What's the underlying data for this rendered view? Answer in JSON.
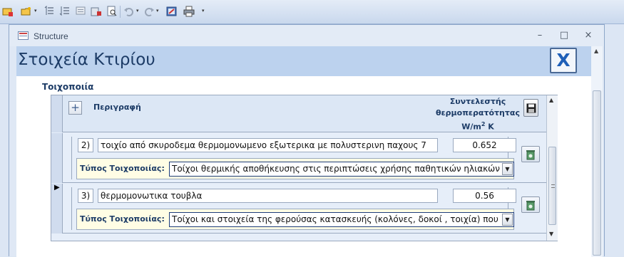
{
  "toolbar": {
    "buttons": [
      "new-record-icon",
      "find-icon",
      "sort-asc-icon",
      "sort-desc-icon",
      "filter-icon",
      "print-preview-icon",
      "undo-icon",
      "redo-icon",
      "report-icon",
      "print-icon",
      "customize-icon"
    ]
  },
  "window": {
    "title": "Structure",
    "minimize": "–",
    "maximize": "□",
    "close": "×"
  },
  "header": {
    "title": "Στοιχεία Κτιρίου",
    "close_label": "X"
  },
  "section": {
    "label": "Τοιχοποιία",
    "add_label": "+",
    "col_desc": "Περιγραφή",
    "col_coef_line1": "Συντελεστής",
    "col_coef_line2": "θερμοπερατότητας",
    "col_coef_unit_base": "W/m",
    "col_coef_unit_sup": "2",
    "col_coef_unit_rest": " K",
    "type_label": "Τύπος Τοιχοποιίας:"
  },
  "records": [
    {
      "num": "2)",
      "desc": "τοιχίο από  σκυροδεμα θερμομονωμενο εξωτερικα με πολυστερινη παχους 7",
      "coef": "0.652",
      "type": "Τοίχοι θερμικής αποθήκευσης στις περιπτώσεις χρήσης παθητικών ηλιακών",
      "current": false
    },
    {
      "num": "3)",
      "desc": "θερμομονωτικα τουβλα",
      "coef": "0.56",
      "type": "Τοίχοι και στοιχεία της φερούσας κατασκευής (κολόνες, δοκοί , τοιχία) που",
      "current": true
    }
  ],
  "colors": {
    "accent": "#1c3b66",
    "header_band": "#bcd2ee",
    "close_x": "#1e5fb8",
    "type_row_bg": "#fffde5"
  }
}
